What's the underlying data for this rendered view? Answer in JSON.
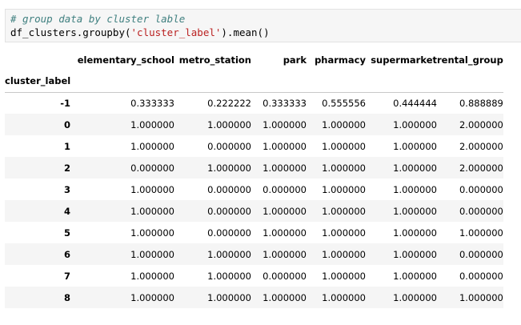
{
  "code": {
    "comment": "# group data by cluster lable",
    "line2_prefix": "df_clusters.groupby(",
    "line2_string": "'cluster_label'",
    "line2_suffix": ").mean()"
  },
  "table": {
    "index_name": "cluster_label",
    "columns": [
      "elementary_school",
      "metro_station",
      "park",
      "pharmacy",
      "supermarket",
      "rental_group"
    ],
    "rows": [
      {
        "index": "-1",
        "values": [
          "0.333333",
          "0.222222",
          "0.333333",
          "0.555556",
          "0.444444",
          "0.888889"
        ]
      },
      {
        "index": "0",
        "values": [
          "1.000000",
          "1.000000",
          "1.000000",
          "1.000000",
          "1.000000",
          "2.000000"
        ]
      },
      {
        "index": "1",
        "values": [
          "1.000000",
          "0.000000",
          "1.000000",
          "1.000000",
          "1.000000",
          "2.000000"
        ]
      },
      {
        "index": "2",
        "values": [
          "0.000000",
          "1.000000",
          "1.000000",
          "1.000000",
          "1.000000",
          "2.000000"
        ]
      },
      {
        "index": "3",
        "values": [
          "1.000000",
          "0.000000",
          "0.000000",
          "1.000000",
          "1.000000",
          "0.000000"
        ]
      },
      {
        "index": "4",
        "values": [
          "1.000000",
          "0.000000",
          "1.000000",
          "1.000000",
          "1.000000",
          "0.000000"
        ]
      },
      {
        "index": "5",
        "values": [
          "1.000000",
          "0.000000",
          "1.000000",
          "1.000000",
          "1.000000",
          "1.000000"
        ]
      },
      {
        "index": "6",
        "values": [
          "1.000000",
          "1.000000",
          "1.000000",
          "1.000000",
          "1.000000",
          "0.000000"
        ]
      },
      {
        "index": "7",
        "values": [
          "1.000000",
          "1.000000",
          "0.000000",
          "1.000000",
          "1.000000",
          "0.000000"
        ]
      },
      {
        "index": "8",
        "values": [
          "1.000000",
          "1.000000",
          "1.000000",
          "1.000000",
          "1.000000",
          "1.000000"
        ]
      }
    ]
  },
  "colors": {
    "code_background": "#f6f6f6",
    "comment": "#408080",
    "string": "#ba2121",
    "stripe": "#f5f5f5"
  }
}
